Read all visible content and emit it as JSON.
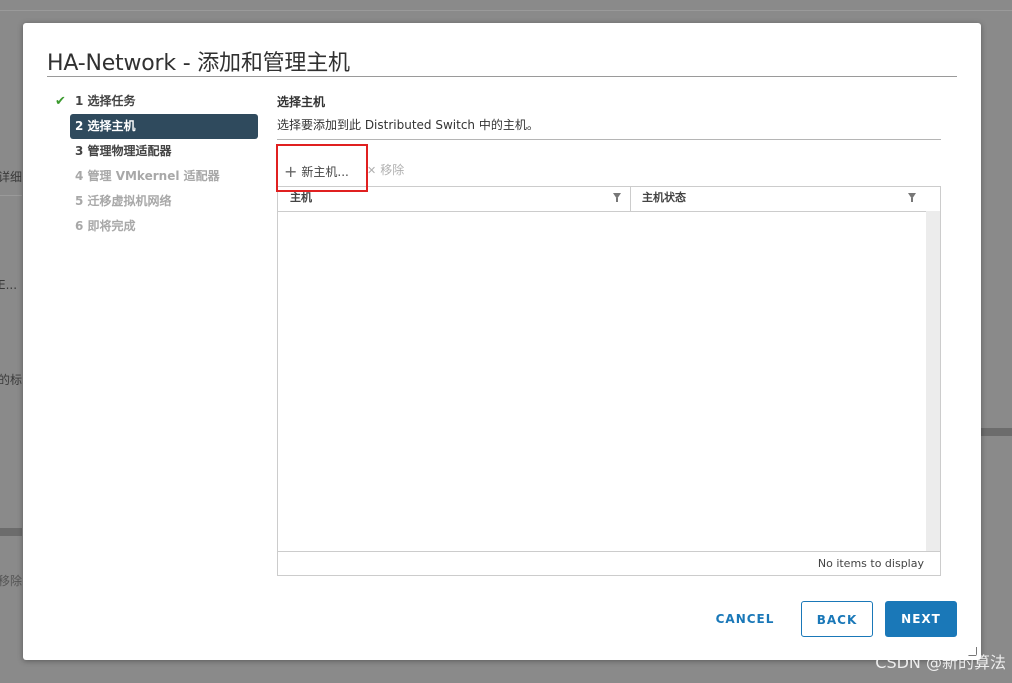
{
  "background": {
    "fragments": [
      "详细",
      "E...",
      "的标",
      "移除"
    ]
  },
  "dialog": {
    "title": "HA-Network - 添加和管理主机",
    "steps": [
      {
        "label": "1 选择任务",
        "state": "done"
      },
      {
        "label": "2 选择主机",
        "state": "active"
      },
      {
        "label": "3 管理物理适配器",
        "state": "normal"
      },
      {
        "label": "4 管理 VMkernel 适配器",
        "state": "disabled"
      },
      {
        "label": "5 迁移虚拟机网络",
        "state": "disabled"
      },
      {
        "label": "6 即将完成",
        "state": "disabled"
      }
    ],
    "section_title": "选择主机",
    "section_desc": "选择要添加到此 Distributed Switch 中的主机。",
    "toolbar": {
      "add_label": "新主机...",
      "remove_label": "移除"
    },
    "grid": {
      "columns": [
        "主机",
        "主机状态"
      ],
      "rows": [],
      "footer": "No items to display"
    },
    "buttons": {
      "cancel": "CANCEL",
      "back": "BACK",
      "next": "NEXT"
    }
  },
  "watermark": "CSDN @新的算法",
  "colors": {
    "accent": "#1a78b8",
    "active_step": "#2f4a5d",
    "check": "#3b9a2e",
    "highlight": "#e02020"
  }
}
